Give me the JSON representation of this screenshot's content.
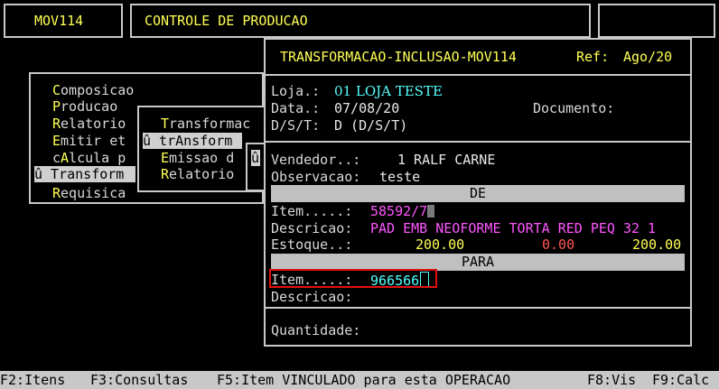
{
  "header": {
    "program_code": "MOV114",
    "program_title": "CONTROLE DE PRODUCAO"
  },
  "main_menu": {
    "items": [
      {
        "hot": "C",
        "rest": "omposicao"
      },
      {
        "hot": "P",
        "rest": "roducao"
      },
      {
        "hot": "R",
        "rest": "elatorio"
      },
      {
        "hot": "E",
        "rest": "mitir et"
      },
      {
        "hot": "A",
        "pre": "c",
        "rest": "lcula p"
      },
      {
        "hot": "",
        "rest": "û Transform",
        "selected": true
      },
      {
        "hot": "R",
        "rest": "equisica"
      }
    ]
  },
  "sub_menu": {
    "items": [
      {
        "hot": "T",
        "rest": "ransformac"
      },
      {
        "pre": "û t",
        "hot": "rA",
        "rest": "nsform",
        "selected": true
      },
      {
        "hot": "E",
        "rest": "missao d"
      },
      {
        "hot": "R",
        "rest": "elatorio"
      }
    ],
    "side_char": "û"
  },
  "dialog": {
    "title": "TRANSFORMACAO-INCLUSAO-MOV114",
    "ref_label": "Ref:",
    "ref_value": "Ago/20",
    "loja_label": "Loja.:",
    "loja_value": "01 LOJA TESTE",
    "data_label": "Data.:",
    "data_value": "07/08/20",
    "documento_label": "Documento:",
    "dst_label": "D/S/T:",
    "dst_value": "D (D/S/T)",
    "vendedor_label": "Vendedor..:",
    "vendedor_value": "1 RALF CARNE",
    "observacao_label": "Observacao:",
    "observacao_value": "teste",
    "de_section": "DE",
    "de_item_label": "Item.....:",
    "de_item_value": "58592/7",
    "de_descricao_label": "Descricao:",
    "de_descricao_value": "PAD EMB NEOFORME TORTA RED PEQ 32 1",
    "estoque_label": "Estoque..:",
    "estoque_values": [
      "200.00",
      "0.00",
      "200.00"
    ],
    "para_section": "PARA",
    "para_item_label": "Item.....:",
    "para_item_value": "966566",
    "para_descricao_label": "Descricao:",
    "quantidade_label": "Quantidade:"
  },
  "footer": {
    "f2": "F2:Itens",
    "f3": "F3:Consultas",
    "f5": "F5:Item VINCULADO para esta OPERACAO",
    "f8": "F8:Vis",
    "f9": "F9:Calc"
  },
  "colors": {
    "background": "#000000",
    "label": "#d8d8d8",
    "title": "#ffff55",
    "input": "#55ffff",
    "de_value": "#ff55ff",
    "negative": "#ff5555",
    "highlight_box": "#e01010"
  }
}
